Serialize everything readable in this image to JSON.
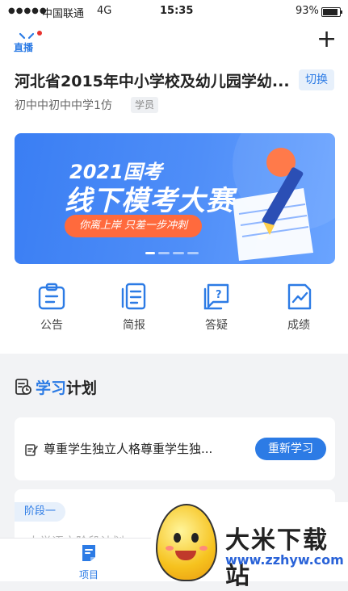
{
  "status_bar": {
    "signal": "●●●●●",
    "carrier": "中国联通",
    "network": "4G",
    "time": "15:35",
    "battery": "93%",
    "battery_level": 0.93
  },
  "header": {
    "logo_label": "直播",
    "title": "河北省2015年中小学校及幼儿园学幼...",
    "switch_label": "切换",
    "subtitle": "初中中初中中学1仿",
    "role_badge": "学员"
  },
  "banner": {
    "line1": "2021国考",
    "line2": "线下模考大赛",
    "pill": "你离上岸 只差一步冲刺",
    "active_index": 0,
    "count": 4
  },
  "quick_actions": [
    {
      "label": "公告",
      "icon": "notice-icon"
    },
    {
      "label": "简报",
      "icon": "report-icon"
    },
    {
      "label": "答疑",
      "icon": "question-icon"
    },
    {
      "label": "成绩",
      "icon": "score-icon"
    }
  ],
  "study_plan": {
    "title_highlight": "学习",
    "title_rest": "计划",
    "item_text": "尊重学生独立人格尊重学生独...",
    "item_button": "重新学习",
    "stage_label": "阶段一",
    "stage_partial": "大学语文阶段计划"
  },
  "tabbar": {
    "active_label": "项目"
  },
  "watermark": {
    "name": "大米下载站",
    "url": "www.zzhyw.com"
  },
  "colors": {
    "accent": "#2c7be5",
    "banner_orange": "#ff6a3d"
  }
}
